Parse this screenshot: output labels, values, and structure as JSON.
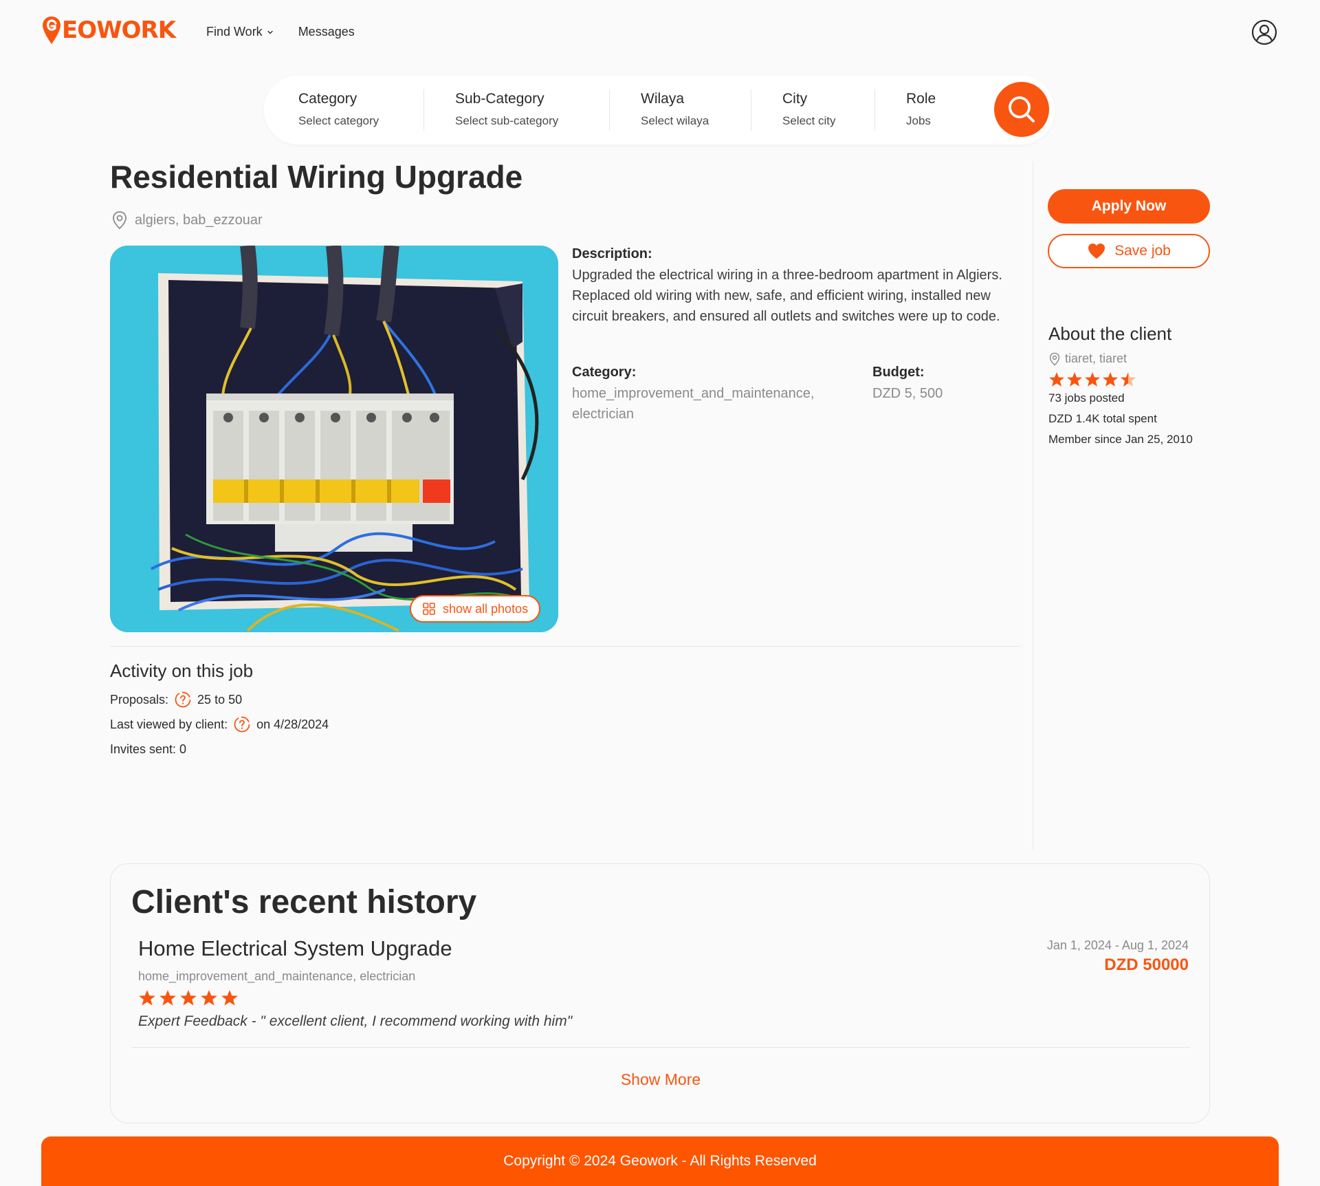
{
  "brand": {
    "name": "GEOWORK",
    "accent": "#f85510"
  },
  "nav": {
    "find_work": "Find Work",
    "messages": "Messages"
  },
  "search": {
    "fields": [
      {
        "label": "Category",
        "value": "Select category"
      },
      {
        "label": "Sub-Category",
        "value": "Select sub-category"
      },
      {
        "label": "Wilaya",
        "value": "Select wilaya"
      },
      {
        "label": "City",
        "value": "Select city"
      },
      {
        "label": "Role",
        "value": "Jobs"
      }
    ]
  },
  "job": {
    "title": "Residential Wiring Upgrade",
    "location": "algiers, bab_ezzouar",
    "show_photos": "show all photos",
    "description_label": "Description:",
    "description": "Upgraded the electrical wiring in a three-bedroom apartment in Algiers. Replaced old wiring with new, safe, and efficient wiring, installed new circuit breakers, and ensured all outlets and switches were up to code.",
    "category_label": "Category:",
    "category_value": "home_improvement_and_maintenance, electrician",
    "budget_label": "Budget:",
    "budget_value": "DZD 5, 500"
  },
  "activity": {
    "title": "Activity on this job",
    "proposals_label": "Proposals:",
    "proposals_value": "25 to 50",
    "last_viewed_label": "Last viewed by client:",
    "last_viewed_value": "on 4/28/2024",
    "invites": "Invites sent: 0"
  },
  "actions": {
    "apply": "Apply Now",
    "save": "Save job"
  },
  "client": {
    "title": "About the client",
    "location": "tiaret, tiaret",
    "rating": 4.5,
    "jobs_posted": "73 jobs posted",
    "total_spent": "DZD 1.4K total spent",
    "member_since": "Member since Jan 25, 2010"
  },
  "history": {
    "title": "Client's recent history",
    "items": [
      {
        "title": "Home Electrical System Upgrade",
        "category": "home_improvement_and_maintenance, electrician",
        "rating": 5,
        "feedback": "Expert Feedback - \" excellent client, I recommend working with him\"",
        "dates": "Jan 1, 2024 - Aug 1, 2024",
        "amount": "DZD 50000"
      }
    ],
    "show_more": "Show More"
  },
  "footer": {
    "text": "Copyright © 2024 Geowork - All Rights Reserved"
  }
}
